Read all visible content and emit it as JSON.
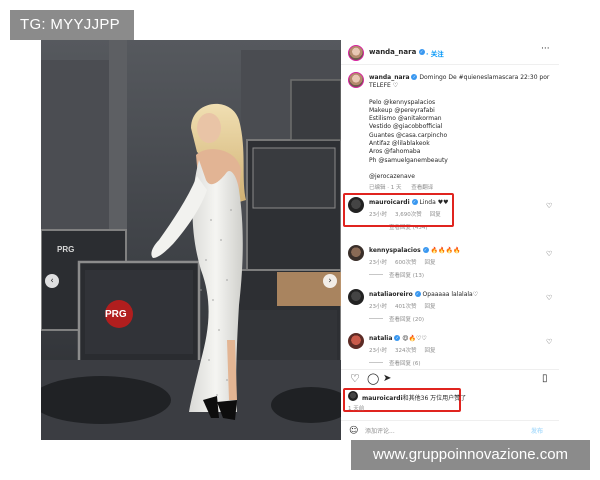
{
  "watermarks": {
    "top": "TG: MYYJJPP",
    "bottom": "www.gruppoinnovazione.com"
  },
  "post": {
    "author": "wanda_nara",
    "follow_label": "关注",
    "carousel": {
      "slides": 7,
      "active": 1
    },
    "caption": {
      "line1": "Domingo De #quieneslamascara 22:30 por",
      "line2": "TELEFE ♡",
      "credits": [
        "Pelo @kennyspalacios",
        "Makeup @pereyrafabi",
        "Estilismo @anitakorman",
        "Vestido @giacobbofficial",
        "Guantes @casa.carpincho",
        "Antifaz @lilablakeok",
        "Aros @fahomaba",
        "Ph @samuelganembeauty"
      ],
      "mention": "@jerocazenave",
      "meta_time": "已编辑 · 1 天",
      "meta_translate": "查看翻译"
    },
    "comments": [
      {
        "user": "mauroicardi",
        "text": "Linda ♥♥",
        "time": "23小时",
        "likes": "3,690次赞",
        "reply": "回复",
        "view_replies": "查看回复 (454)"
      },
      {
        "user": "kennyspalacios",
        "text": "🔥🔥🔥🔥",
        "time": "23小时",
        "likes": "600次赞",
        "reply": "回复",
        "view_replies": "查看回复 (13)"
      },
      {
        "user": "nataliaoreiro",
        "text": "Opaaaaa lalalala♡",
        "time": "23小时",
        "likes": "401次赞",
        "reply": "回复",
        "view_replies": "查看回复 (20)"
      },
      {
        "user": "natalia",
        "text": "😍🔥♡♡",
        "time": "23小时",
        "likes": "324次赞",
        "reply": "回复",
        "view_replies": "查看回复 (6)"
      }
    ],
    "liked_by": {
      "prefix": "mauroicardi",
      "suffix": "和其他36 万位用户赞了"
    },
    "age": "1 天前",
    "comment_placeholder": "添加评论...",
    "post_label": "发布"
  },
  "colors": {
    "accent": "#0095f6",
    "highlight": "#e0241f",
    "verified": "#3897f0"
  },
  "icons": [
    "more-icon",
    "heart-icon",
    "comment-icon",
    "share-icon",
    "bookmark-icon",
    "emoji-icon",
    "verified-icon",
    "chevron-left-icon",
    "chevron-right-icon"
  ]
}
